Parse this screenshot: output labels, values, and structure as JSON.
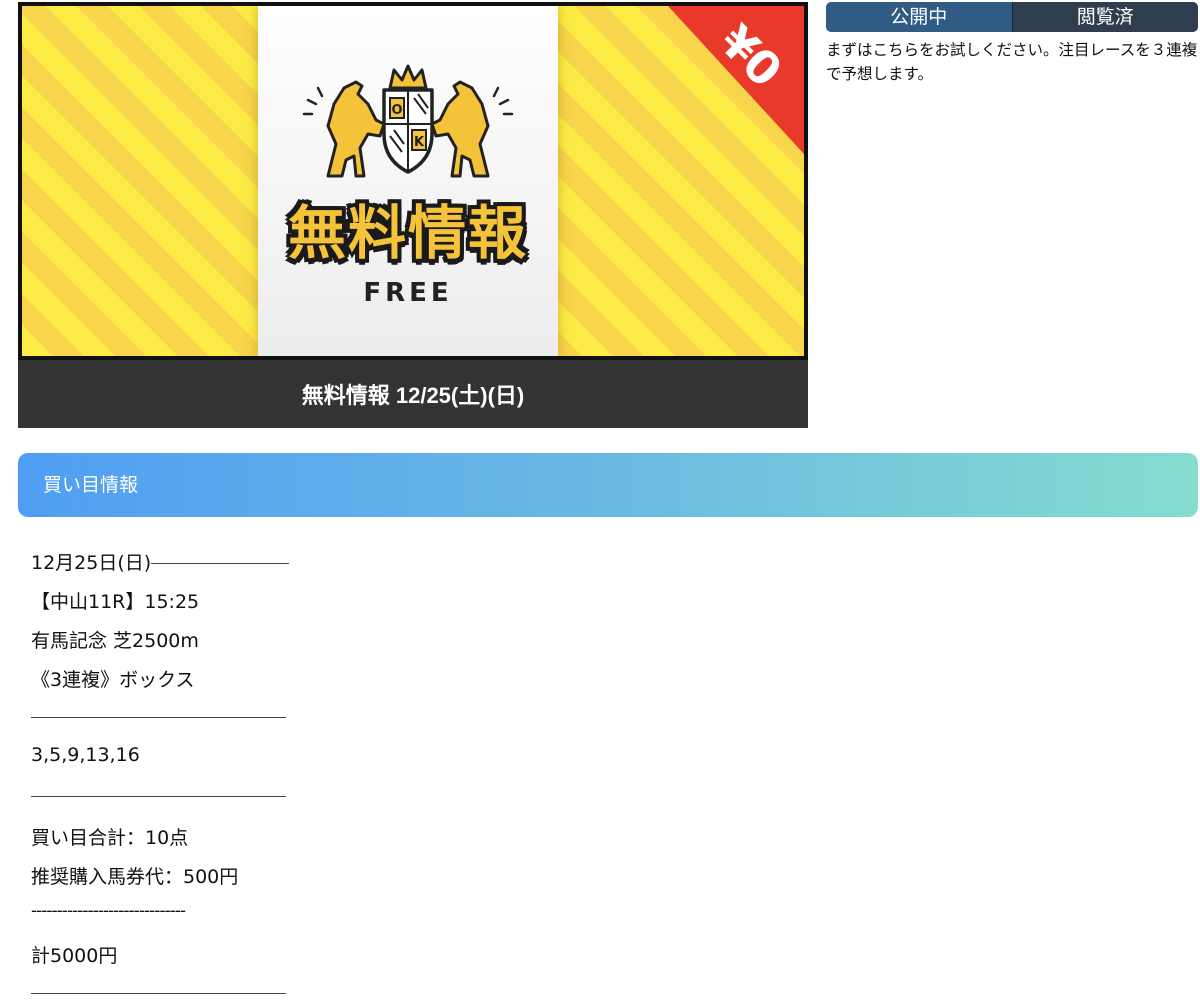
{
  "banner": {
    "title": "無料情報",
    "subtitle": "FREE",
    "corner_label": "¥0",
    "crest_letters": [
      "O",
      "K"
    ],
    "caption": "無料情報 12/25(土)(日)",
    "colors": {
      "stripe_light": "#fdeb45",
      "stripe_dark": "#f8d54a",
      "corner": "#e8392a",
      "caption_bg": "#333333"
    }
  },
  "status": {
    "tabs": [
      {
        "label": "公開中",
        "color": "#2f5b85"
      },
      {
        "label": "閲覧済",
        "color": "#2e3e4e"
      }
    ],
    "intro": "まずはこちらをお試しください。注目レースを３連複で予想します。"
  },
  "section": {
    "title": "買い目情報"
  },
  "tip": {
    "date": "12月25日(日)",
    "race": "【中山11R】15:25",
    "race_name": "有馬記念 芝2500m",
    "bet_type": "《3連複》ボックス",
    "horses": "3,5,9,13,16",
    "total_combos": "買い目合計：10点",
    "recommended": "推奨購入馬券代：500円",
    "dash_divider": "------------------------------",
    "grand_total": "計5000円"
  }
}
